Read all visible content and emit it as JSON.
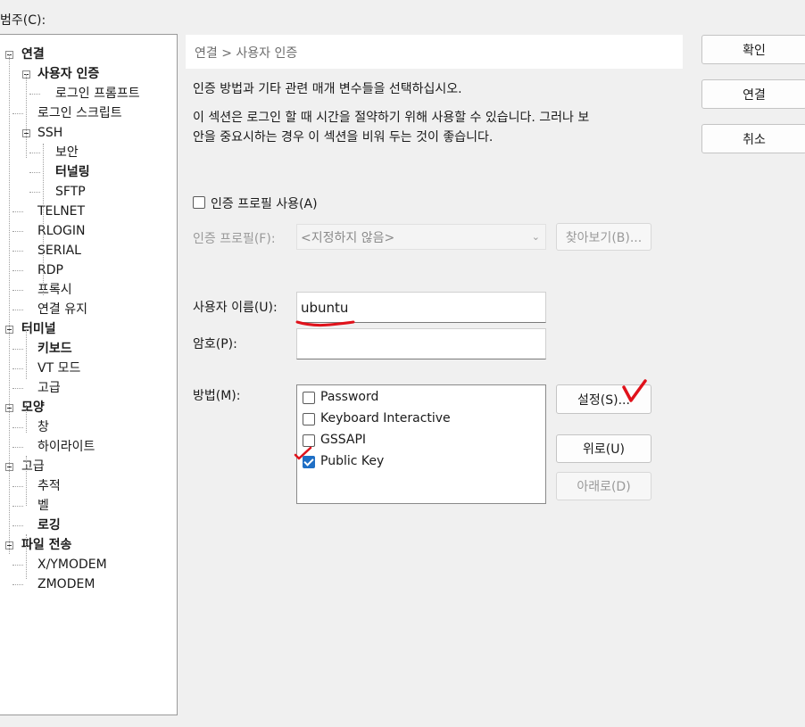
{
  "category_label": "범주(C):",
  "tree": {
    "items": [
      {
        "label": "연결",
        "bold": true,
        "expander": true
      },
      {
        "label": "사용자 인증",
        "bold": true,
        "expander": true,
        "selected": true
      },
      {
        "label": "로그인 프롬프트"
      },
      {
        "label": "로그인 스크립트"
      },
      {
        "label": "SSH",
        "expander": true
      },
      {
        "label": "보안"
      },
      {
        "label": "터널링",
        "bold": true
      },
      {
        "label": "SFTP"
      },
      {
        "label": "TELNET"
      },
      {
        "label": "RLOGIN"
      },
      {
        "label": "SERIAL"
      },
      {
        "label": "RDP"
      },
      {
        "label": "프록시"
      },
      {
        "label": "연결 유지"
      },
      {
        "label": "터미널",
        "bold": true,
        "expander": true
      },
      {
        "label": "키보드",
        "bold": true
      },
      {
        "label": "VT 모드"
      },
      {
        "label": "고급"
      },
      {
        "label": "모양",
        "bold": true,
        "expander": true
      },
      {
        "label": "창"
      },
      {
        "label": "하이라이트"
      },
      {
        "label": "고급",
        "expander": true
      },
      {
        "label": "추적"
      },
      {
        "label": "벨"
      },
      {
        "label": "로깅",
        "bold": true
      },
      {
        "label": "파일 전송",
        "bold": true,
        "expander": true
      },
      {
        "label": "X/YMODEM"
      },
      {
        "label": "ZMODEM"
      }
    ]
  },
  "breadcrumb": "연결 > 사용자 인증",
  "description": {
    "line1": "인증 방법과 기타 관련 매개 변수들을 선택하십시오.",
    "line2": "이 섹션은 로그인 할 때 시간을 절약하기 위해 사용할 수 있습니다. 그러나 보",
    "line3": "안을 중요시하는 경우 이 섹션을 비워 두는 것이 좋습니다."
  },
  "auth_profile": {
    "checkbox_label": "인증 프로필 사용(A)",
    "checked": false,
    "field_label": "인증 프로필(F):",
    "selected_value": "<지정하지 않음>",
    "browse_label": "찾아보기(B)..."
  },
  "username": {
    "label": "사용자 이름(U):",
    "value": "ubuntu"
  },
  "password": {
    "label": "암호(P):",
    "value": ""
  },
  "method": {
    "label": "방법(M):",
    "options": [
      {
        "label": "Password",
        "checked": false
      },
      {
        "label": "Keyboard Interactive",
        "checked": false
      },
      {
        "label": "GSSAPI",
        "checked": false
      },
      {
        "label": "Public Key",
        "checked": true
      }
    ],
    "settings_label": "설정(S)...",
    "up_label": "위로(U)",
    "down_label": "아래로(D)"
  },
  "dialog_buttons": {
    "ok": "확인",
    "connect": "연결",
    "cancel": "취소"
  },
  "colors": {
    "checkbox_checked": "#1f6fc5",
    "annotation_red": "#e0121b",
    "breadcrumb": "#6d6d6d"
  }
}
